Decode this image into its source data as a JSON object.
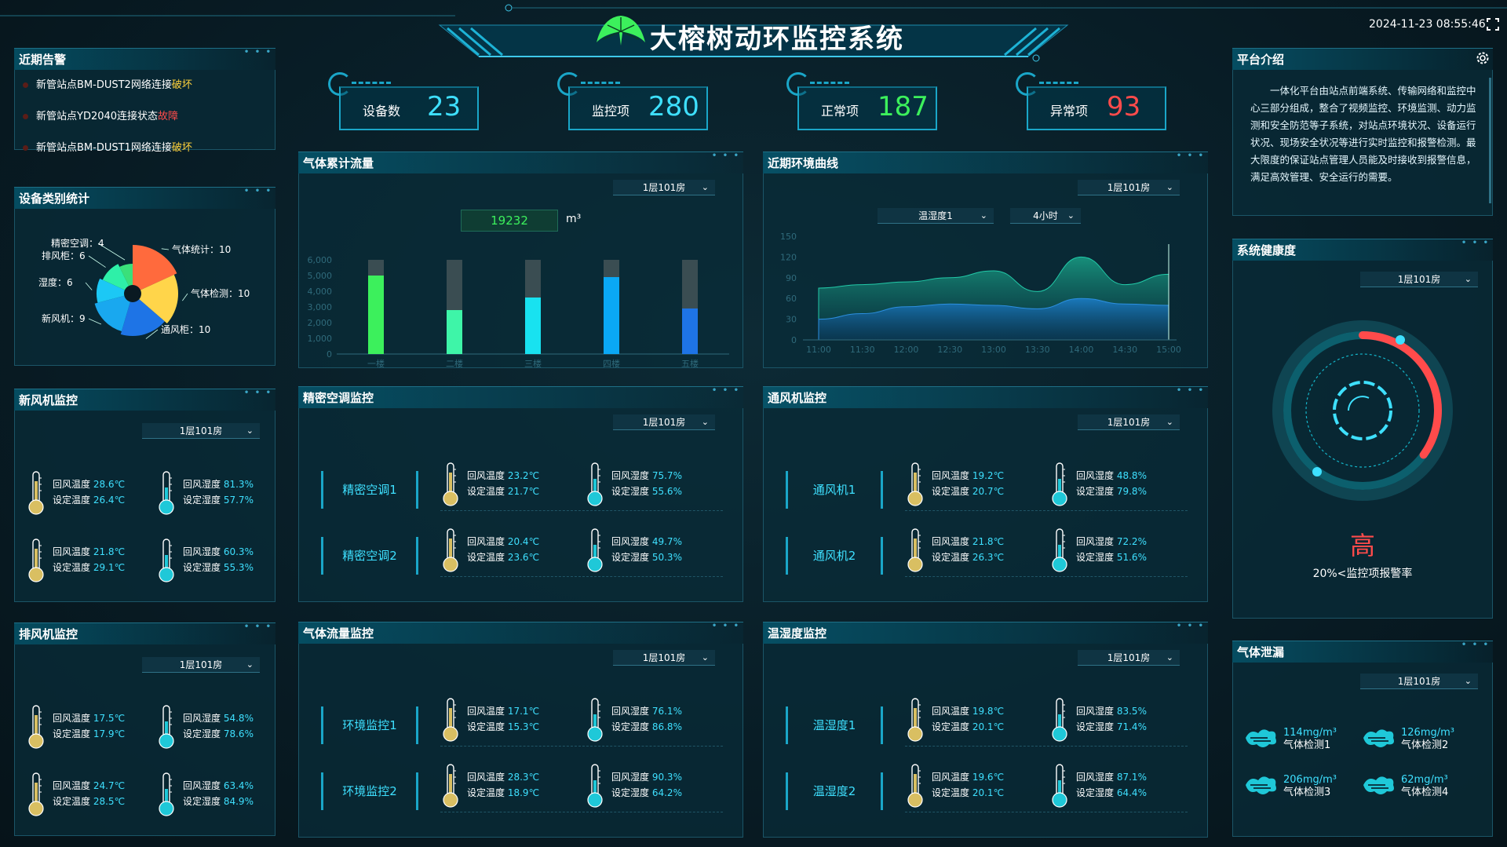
{
  "header": {
    "title": "大榕树动环监控系统",
    "datetime": "2024-11-23 08:55:46",
    "expand_icon": "fullscreen-icon",
    "logo_icon": "banyan-tree-logo"
  },
  "stats": [
    {
      "label": "设备数",
      "value": "23",
      "color": "#3ee0ff"
    },
    {
      "label": "监控项",
      "value": "280",
      "color": "#3ee0ff"
    },
    {
      "label": "正常项",
      "value": "187",
      "color": "#3cf05c"
    },
    {
      "label": "异常项",
      "value": "93",
      "color": "#ff4b4b"
    }
  ],
  "alarms": {
    "title": "近期告警",
    "items": [
      {
        "text": "新管站点BM-DUST2网络连接",
        "status": "破坏",
        "status_color": "#ffd23c"
      },
      {
        "text": "新管站点YD2040连接状态",
        "status": "故障",
        "status_color": "#ff4b4b"
      },
      {
        "text": "新管站点BM-DUST1网络连接",
        "status": "破坏",
        "status_color": "#ffd23c"
      }
    ]
  },
  "device_stats": {
    "title": "设备类别统计",
    "chart_data": {
      "type": "pie",
      "slices": [
        {
          "label": "气体统计",
          "value": 10,
          "color": "#ff6a3d",
          "text": "气体统计：10"
        },
        {
          "label": "气体检测",
          "value": 10,
          "color": "#ffd54a",
          "text": "气体检测：10"
        },
        {
          "label": "通风柜",
          "value": 10,
          "color": "#1e74e6",
          "text": "通风柜：10"
        },
        {
          "label": "新风机",
          "value": 9,
          "color": "#19a8ef",
          "text": "新风机：9"
        },
        {
          "label": "湿度",
          "value": 6,
          "color": "#1cc8f5",
          "text": "湿度：6"
        },
        {
          "label": "排风柜",
          "value": 6,
          "color": "#2ef0a8",
          "text": "排风柜：6"
        },
        {
          "label": "精密空调",
          "value": 4,
          "color": "#3ae07a",
          "text": "精密空调：4"
        }
      ]
    }
  },
  "gas_flow": {
    "title": "气体累计流量",
    "room": "1层101房",
    "total": "19232",
    "unit": "m³",
    "chart_data": {
      "type": "bar",
      "categories": [
        "一楼",
        "二楼",
        "三楼",
        "四楼",
        "五楼"
      ],
      "values": [
        5000,
        2800,
        3600,
        4900,
        2900
      ],
      "background_max": 6000,
      "ylim": [
        0,
        6000
      ],
      "yticks": [
        "6,000",
        "5,000",
        "4,000",
        "3,000",
        "2,000",
        "1,000",
        "0"
      ],
      "colors": [
        "#3cf05c",
        "#3ef5a8",
        "#18e2f0",
        "#0aa8f5",
        "#1e74e6"
      ]
    }
  },
  "env_curve": {
    "title": "近期环境曲线",
    "room": "1层101房",
    "sensor": "温湿度1",
    "range": "4小时",
    "chart_data": {
      "type": "area",
      "x": [
        "11:00",
        "11:30",
        "12:00",
        "12:30",
        "13:00",
        "13:30",
        "14:00",
        "14:30",
        "15:00"
      ],
      "series": [
        {
          "values": [
            75,
            80,
            84,
            90,
            100,
            70,
            120,
            80,
            95
          ]
        },
        {
          "values": [
            30,
            38,
            48,
            52,
            50,
            45,
            60,
            52,
            50
          ]
        }
      ],
      "ylim": [
        0,
        150
      ],
      "yticks": [
        "150",
        "120",
        "90",
        "60",
        "30",
        "0"
      ]
    }
  },
  "intro": {
    "title": "平台介绍",
    "settings_icon": "gear-icon",
    "text": "一体化平台由站点前端系统、传输网络和监控中心三部分组成，整合了视频监控、环境监测、动力监测和安全防范等子系统，对站点环境状况、设备运行状况、现场安全状况等进行实时监控和报警检测。最大限度的保证站点管理人员能及时接收到报警信息，满足高效管理、安全运行的需要。"
  },
  "health": {
    "title": "系统健康度",
    "room": "1层101房",
    "level": "高",
    "desc": "20%<监控项报警率",
    "progress": 0.35
  },
  "fresh_air": {
    "title": "新风机监控",
    "room": "1层101房",
    "rows": [
      [
        {
          "l1": "回风温度",
          "v1": "28.6℃",
          "l2": "设定温度",
          "v2": "26.4℃",
          "type": "temp"
        },
        {
          "l1": "回风湿度",
          "v1": "81.3%",
          "l2": "设定湿度",
          "v2": "57.7%",
          "type": "hum"
        }
      ],
      [
        {
          "l1": "回风温度",
          "v1": "21.8℃",
          "l2": "设定温度",
          "v2": "29.1℃",
          "type": "temp"
        },
        {
          "l1": "回风湿度",
          "v1": "60.3%",
          "l2": "设定湿度",
          "v2": "55.3%",
          "type": "hum"
        }
      ]
    ]
  },
  "exhaust": {
    "title": "排风机监控",
    "room": "1层101房",
    "rows": [
      [
        {
          "l1": "回风温度",
          "v1": "17.5℃",
          "l2": "设定温度",
          "v2": "17.9℃",
          "type": "temp"
        },
        {
          "l1": "回风湿度",
          "v1": "54.8%",
          "l2": "设定湿度",
          "v2": "78.6%",
          "type": "hum"
        }
      ],
      [
        {
          "l1": "回风温度",
          "v1": "24.7℃",
          "l2": "设定温度",
          "v2": "28.5℃",
          "type": "temp"
        },
        {
          "l1": "回风湿度",
          "v1": "63.4%",
          "l2": "设定湿度",
          "v2": "84.9%",
          "type": "hum"
        }
      ]
    ]
  },
  "ac": {
    "title": "精密空调监控",
    "room": "1层101房",
    "devices": [
      {
        "name": "精密空调1",
        "temp": {
          "l1": "回风温度",
          "v1": "23.2℃",
          "l2": "设定温度",
          "v2": "21.7℃"
        },
        "hum": {
          "l1": "回风湿度",
          "v1": "75.7%",
          "l2": "设定湿度",
          "v2": "55.6%"
        }
      },
      {
        "name": "精密空调2",
        "temp": {
          "l1": "回风温度",
          "v1": "20.4℃",
          "l2": "设定温度",
          "v2": "23.6℃"
        },
        "hum": {
          "l1": "回风湿度",
          "v1": "49.7%",
          "l2": "设定湿度",
          "v2": "50.3%"
        }
      }
    ]
  },
  "vent": {
    "title": "通风机监控",
    "room": "1层101房",
    "devices": [
      {
        "name": "通风机1",
        "temp": {
          "l1": "回风温度",
          "v1": "19.2℃",
          "l2": "设定温度",
          "v2": "20.7℃"
        },
        "hum": {
          "l1": "回风湿度",
          "v1": "48.8%",
          "l2": "设定湿度",
          "v2": "79.8%"
        }
      },
      {
        "name": "通风机2",
        "temp": {
          "l1": "回风温度",
          "v1": "21.8℃",
          "l2": "设定温度",
          "v2": "26.3℃"
        },
        "hum": {
          "l1": "回风湿度",
          "v1": "72.2%",
          "l2": "设定湿度",
          "v2": "51.6%"
        }
      }
    ]
  },
  "gas_monitor": {
    "title": "气体流量监控",
    "room": "1层101房",
    "devices": [
      {
        "name": "环境监控1",
        "temp": {
          "l1": "回风温度",
          "v1": "17.1℃",
          "l2": "设定温度",
          "v2": "15.3℃"
        },
        "hum": {
          "l1": "回风湿度",
          "v1": "76.1%",
          "l2": "设定湿度",
          "v2": "86.8%"
        }
      },
      {
        "name": "环境监控2",
        "temp": {
          "l1": "回风温度",
          "v1": "28.3℃",
          "l2": "设定温度",
          "v2": "18.9℃"
        },
        "hum": {
          "l1": "回风湿度",
          "v1": "90.3%",
          "l2": "设定湿度",
          "v2": "64.2%"
        }
      }
    ]
  },
  "th_monitor": {
    "title": "温湿度监控",
    "room": "1层101房",
    "devices": [
      {
        "name": "温湿度1",
        "temp": {
          "l1": "回风温度",
          "v1": "19.8℃",
          "l2": "设定温度",
          "v2": "20.1℃"
        },
        "hum": {
          "l1": "回风湿度",
          "v1": "83.5%",
          "l2": "设定湿度",
          "v2": "71.4%"
        }
      },
      {
        "name": "温湿度2",
        "temp": {
          "l1": "回风温度",
          "v1": "19.6℃",
          "l2": "设定温度",
          "v2": "20.1℃"
        },
        "hum": {
          "l1": "回风湿度",
          "v1": "87.1%",
          "l2": "设定湿度",
          "v2": "64.4%"
        }
      }
    ]
  },
  "gas_leak": {
    "title": "气体泄漏",
    "room": "1层101房",
    "icon": "gas-leak-icon",
    "items": [
      {
        "value": "114mg/m³",
        "label": "气体检测1"
      },
      {
        "value": "126mg/m³",
        "label": "气体检测2"
      },
      {
        "value": "206mg/m³",
        "label": "气体检测3"
      },
      {
        "value": "62mg/m³",
        "label": "气体检测4"
      }
    ]
  }
}
